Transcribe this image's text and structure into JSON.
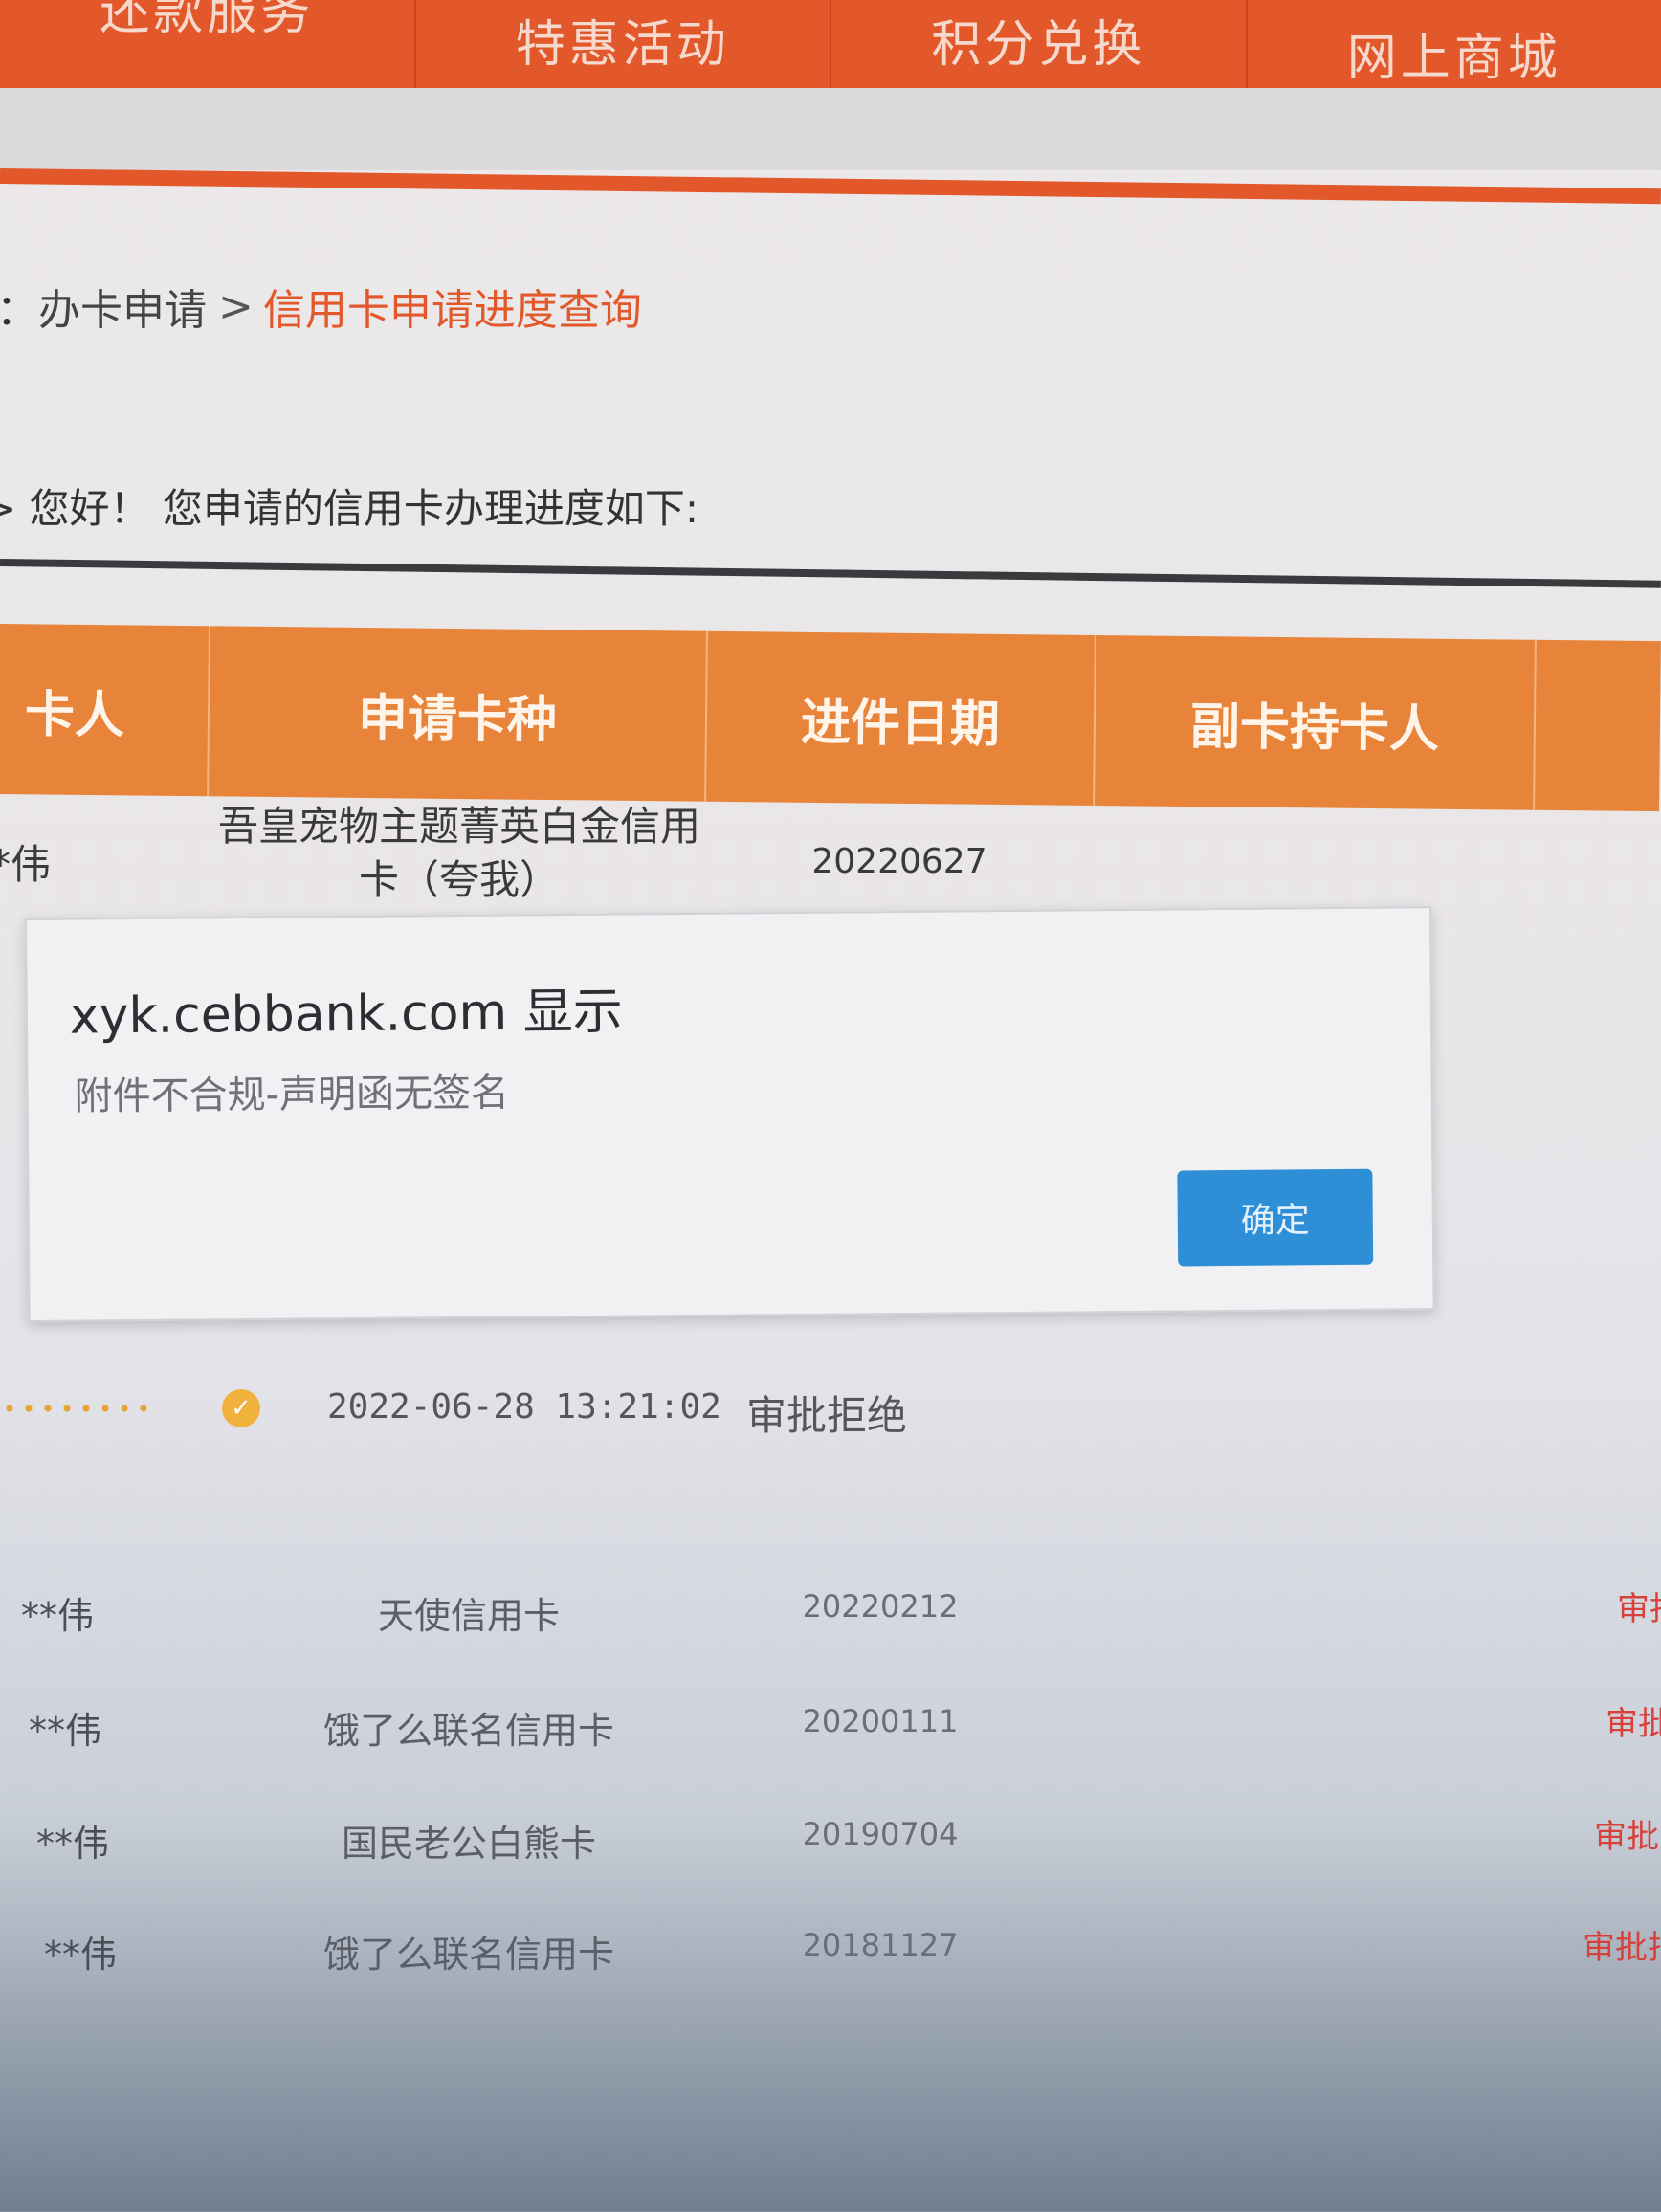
{
  "nav": {
    "items": [
      "还款服务",
      "特惠活动",
      "积分兑换",
      "网上商城"
    ]
  },
  "breadcrumb": {
    "prefix": "：",
    "parent": "办卡申请",
    "separator": ">",
    "current": "信用卡申请进度查询"
  },
  "greeting": "> 您好！ 您申请的信用卡办理进度如下:",
  "table": {
    "headers": [
      "卡人",
      "申请卡种",
      "进件日期",
      "副卡持卡人",
      ""
    ],
    "first_row": {
      "name": "*伟",
      "card": "吾皇宠物主题菁英白金信用卡（夸我）",
      "date": "20220627"
    }
  },
  "dialog": {
    "title": "xyk.cebbank.com 显示",
    "message": "附件不合规-声明函无签名",
    "ok_label": "确定"
  },
  "progress": {
    "time": "2022-06-28 13:21:02",
    "status": "审批拒绝",
    "accent": "#f0b23c"
  },
  "history": [
    {
      "name": "**伟",
      "card": "天使信用卡",
      "date": "20220212",
      "status": "审批"
    },
    {
      "name": "**伟",
      "card": "饿了么联名信用卡",
      "date": "20200111",
      "status": "审批"
    },
    {
      "name": "**伟",
      "card": "国民老公白熊卡",
      "date": "20190704",
      "status": "审批"
    },
    {
      "name": "**伟",
      "card": "饿了么联名信用卡",
      "date": "20181127",
      "status": "审批拒"
    }
  ],
  "colors": {
    "nav_orange": "#e2582a",
    "table_header": "#e88439",
    "dialog_button": "#2f8fd6",
    "reject_red": "#d8403a"
  }
}
